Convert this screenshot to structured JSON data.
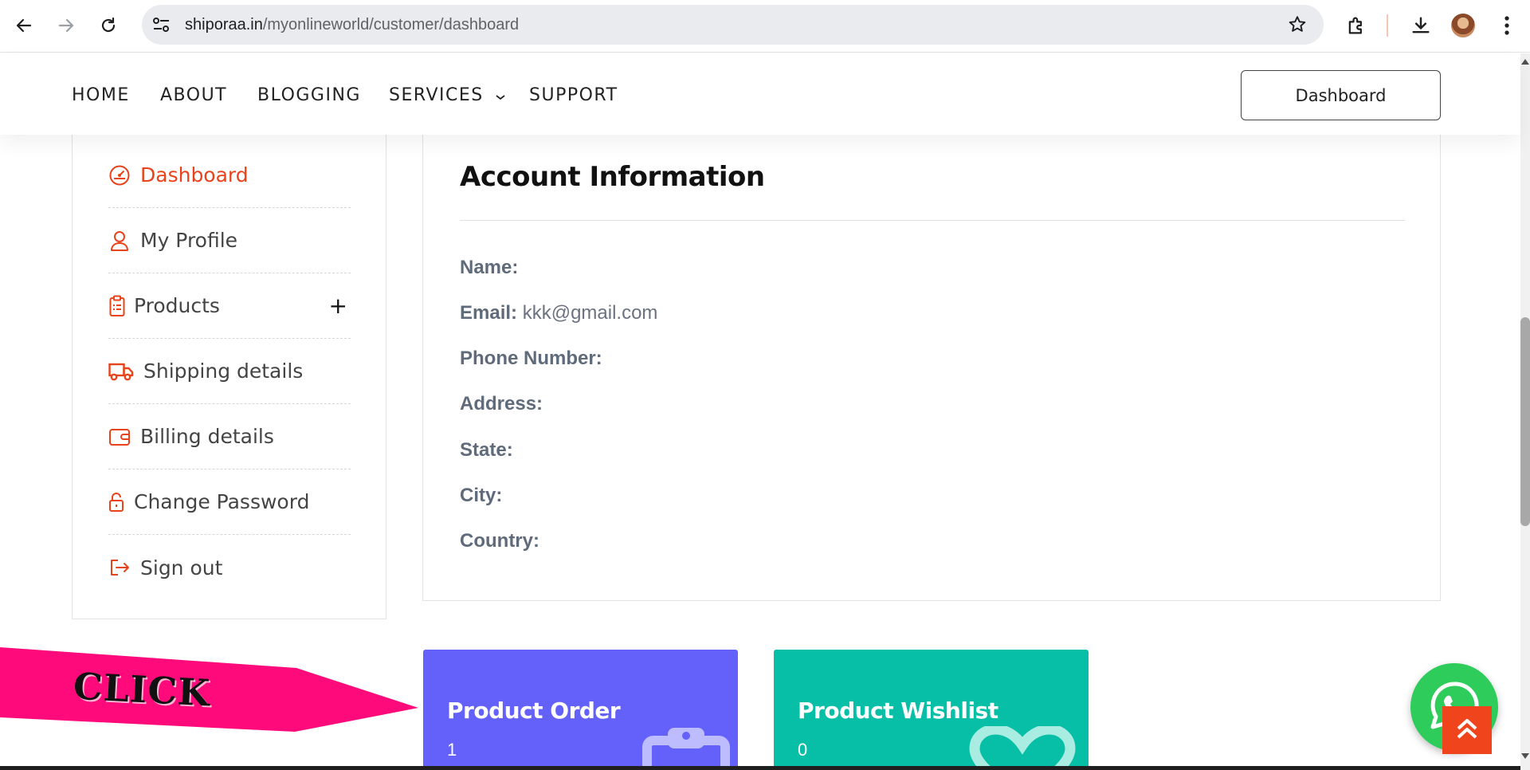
{
  "browser": {
    "url_host": "shiporaa.in",
    "url_path": "/myonlineworld/customer/dashboard"
  },
  "header": {
    "menu": [
      {
        "label": "HOME"
      },
      {
        "label": "ABOUT"
      },
      {
        "label": "BLOGGING"
      },
      {
        "label": "SERVICES"
      },
      {
        "label": "SUPPORT"
      }
    ],
    "dashboard_button": "Dashboard"
  },
  "sidebar": {
    "items": [
      {
        "label": "Dashboard",
        "icon": "speedometer-icon",
        "active": true
      },
      {
        "label": "My Profile",
        "icon": "user-icon"
      },
      {
        "label": "Products",
        "icon": "clipboard-icon",
        "expand": "+"
      },
      {
        "label": "Shipping details",
        "icon": "truck-icon"
      },
      {
        "label": "Billing details",
        "icon": "wallet-icon"
      },
      {
        "label": "Change Password",
        "icon": "lock-icon"
      },
      {
        "label": "Sign out",
        "icon": "sign-out-icon"
      }
    ]
  },
  "account": {
    "title": "Account Information",
    "fields": [
      {
        "key": "Name:",
        "value": ""
      },
      {
        "key": "Email:",
        "value": "kkk@gmail.com"
      },
      {
        "key": "Phone Number:",
        "value": ""
      },
      {
        "key": "Address:",
        "value": ""
      },
      {
        "key": "State:",
        "value": ""
      },
      {
        "key": "City:",
        "value": ""
      },
      {
        "key": "Country:",
        "value": ""
      }
    ]
  },
  "cards": {
    "order": {
      "title": "Product Order",
      "value": "1",
      "icon": "clipboard-icon"
    },
    "wishlist": {
      "title": "Product Wishlist",
      "value": "0",
      "icon": "heart-icon"
    }
  },
  "annotation": {
    "text": "CLICK"
  },
  "colors": {
    "accent": "#e8431a",
    "order_card": "#6460fa",
    "wishlist_card": "#06bfa6",
    "whatsapp": "#2ecc5a",
    "arrow": "#ff0a7a"
  }
}
